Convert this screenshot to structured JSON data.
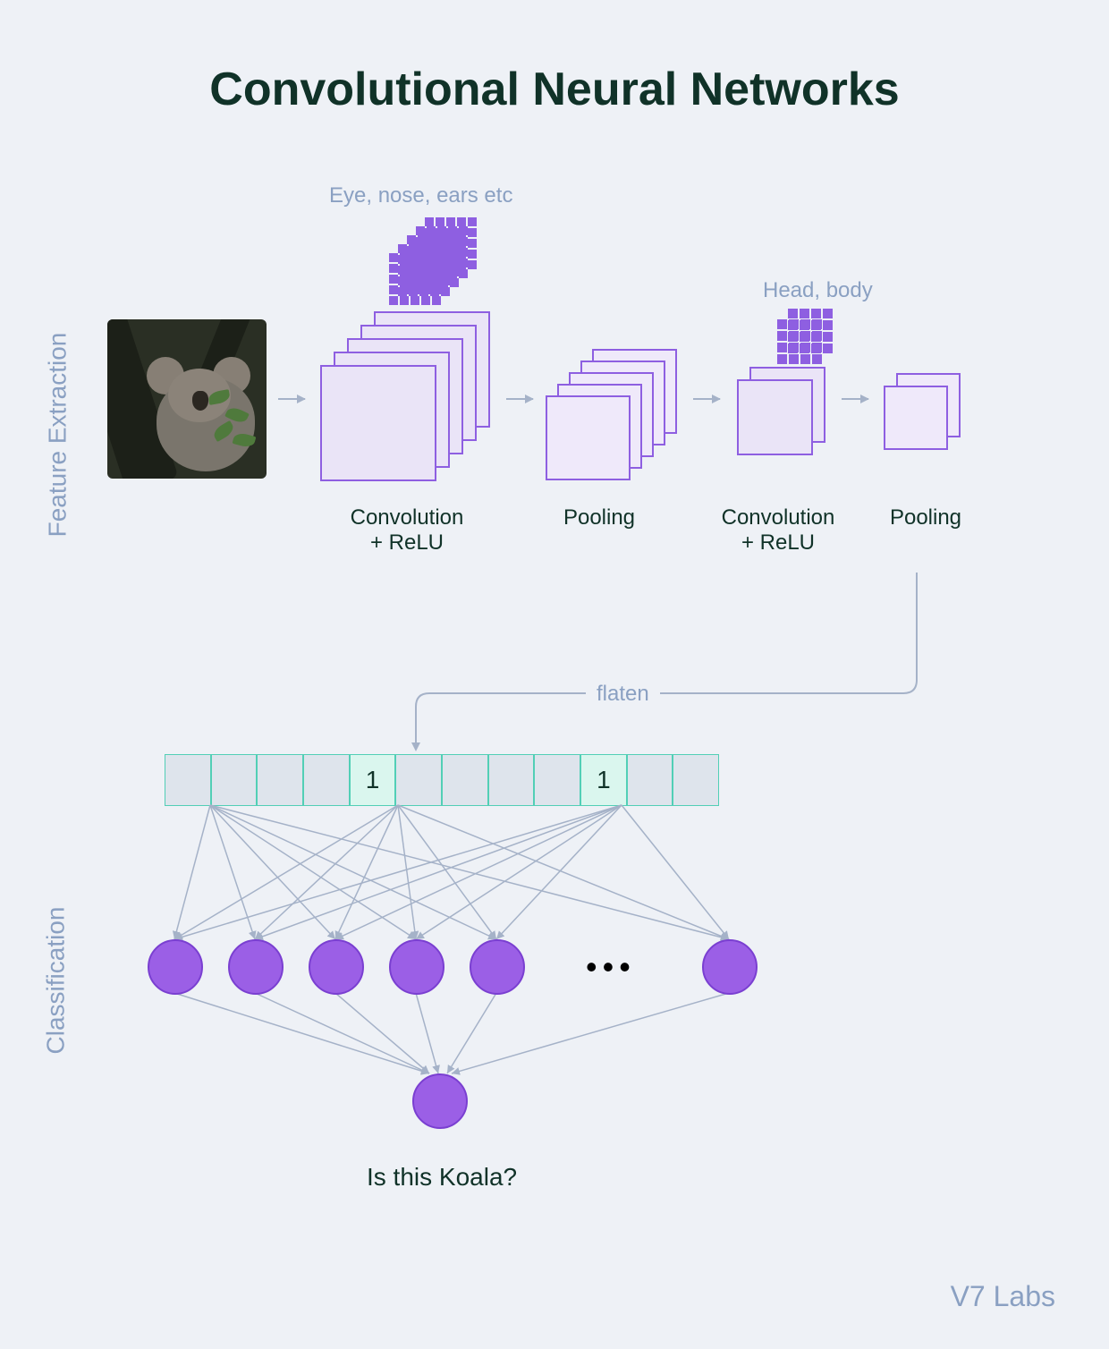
{
  "title": "Convolutional Neural Networks",
  "section_labels": {
    "feature_extraction": "Feature Extraction",
    "classification": "Classification"
  },
  "feature_hints": {
    "conv1": "Eye, nose, ears etc",
    "conv2": "Head, body"
  },
  "stages": {
    "conv1": "Convolution\n+ ReLU",
    "pool1": "Pooling",
    "conv2": "Convolution\n+ ReLU",
    "pool2": "Pooling"
  },
  "flatten_label": "flaten",
  "vector_cells": [
    "",
    "",
    "",
    "",
    "1",
    "",
    "",
    "",
    "",
    "1",
    "",
    ""
  ],
  "ellipsis": "•••",
  "output_question": "Is this Koala?",
  "credit": "V7 Labs",
  "colors": {
    "bg": "#eef1f6",
    "primary": "#8e5fe1",
    "node": "#9b5fe6",
    "teal": "#52cfb6",
    "muted": "#8aa0c2",
    "dark": "#103228"
  }
}
